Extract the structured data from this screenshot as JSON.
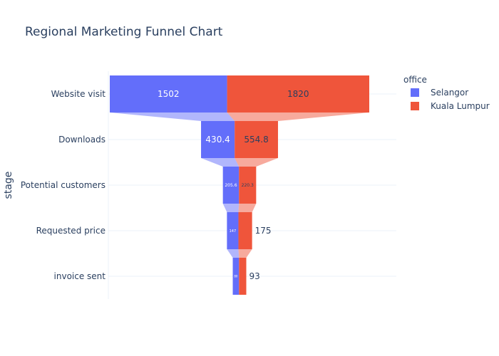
{
  "chart_data": {
    "type": "funnel",
    "title": "Regional Marketing Funnel Chart",
    "ylabel": "stage",
    "xlabel": "",
    "categories": [
      "Website visit",
      "Downloads",
      "Potential customers",
      "Requested price",
      "invoice sent"
    ],
    "legend": {
      "title": "office",
      "placement": "top-right"
    },
    "series": [
      {
        "name": "Selangor",
        "color": "#636efa",
        "values": [
          1502,
          430.4,
          205.6,
          147,
          80
        ],
        "labels": [
          "1502",
          "430.4",
          "205.6",
          "147",
          "80"
        ]
      },
      {
        "name": "Kuala Lumpur",
        "color": "#ef553b",
        "values": [
          1820,
          554.8,
          220.3,
          175,
          93
        ],
        "labels": [
          "1820",
          "554.8",
          "220.3",
          "175",
          "93"
        ]
      }
    ],
    "grid": true
  }
}
